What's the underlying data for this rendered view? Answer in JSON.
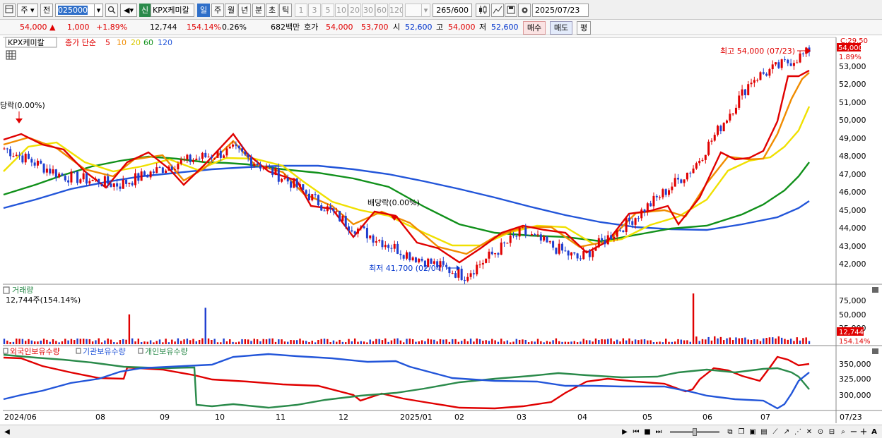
{
  "toolbar": {
    "period_daily": "주",
    "period_prev": "전",
    "stock_code": "025000",
    "market_tag": "신",
    "stock_name": "KPX케미칼",
    "periods": [
      "일",
      "주",
      "월",
      "년",
      "분",
      "초",
      "틱"
    ],
    "active_period": "일",
    "intervals": [
      "1",
      "3",
      "5",
      "10",
      "20",
      "30",
      "60",
      "120"
    ],
    "count_display": "265/600",
    "date": "2025/07/23"
  },
  "info": {
    "price": "54,000",
    "change": "1,000",
    "change_pct": "+1.89%",
    "volume": "12,744",
    "volume_ratio": "154.14%",
    "turnover": "0.26%",
    "amount": "682백만",
    "quote_label": "호가",
    "ask": "54,000",
    "bid": "53,700",
    "open_label": "시",
    "open": "52,600",
    "high_label": "고",
    "high": "54,000",
    "low_label": "저",
    "low": "52,600",
    "buy_label": "매수",
    "sell_label": "매도",
    "avg_label": "평"
  },
  "price_panel": {
    "legend_name": "KPX케미칼",
    "legend_ma": "종가 단순",
    "ma_periods": [
      "5",
      "10",
      "20",
      "60",
      "120"
    ],
    "ma_colors": [
      "#e00000",
      "#f08c00",
      "#f0e000",
      "#10901a",
      "#2255d9"
    ],
    "yaxis_labels": [
      "53,000",
      "52,000",
      "51,000",
      "50,000",
      "49,000",
      "48,000",
      "47,000",
      "46,000",
      "45,000",
      "44,000",
      "43,000",
      "42,000"
    ],
    "corner_label": "C:29.50",
    "current_price_tag": "54,000",
    "current_pct_tag": "1.89%",
    "annotation_high": "최고 54,000 (07/23)",
    "annotation_low": "최저 41,700 (02/04)",
    "annotation_div1": "당락(0.00%)",
    "annotation_div2": "배당락(0.00%)"
  },
  "volume_panel": {
    "title": "거래량",
    "value_label": "12,744주(154.14%)",
    "yaxis_labels": [
      "75,000",
      "50,000",
      "25,000"
    ],
    "tag_value": "12,744",
    "tag_pct": "154.14%"
  },
  "holdings_panel": {
    "legends": [
      "외국인보유수량",
      "기관보유수량",
      "개인보유수량"
    ],
    "colors": [
      "#e00000",
      "#2255d9",
      "#2a8a4a"
    ],
    "yaxis_labels": [
      "350,000",
      "325,000",
      "300,000"
    ]
  },
  "xaxis_labels": [
    "2024/06",
    "08",
    "09",
    "10",
    "11",
    "12",
    "2025/01",
    "02",
    "03",
    "04",
    "05",
    "06",
    "07"
  ],
  "xaxis_end_label": "07/23",
  "chart_data": {
    "type": "candlestick",
    "title": "KPX케미칼",
    "ylim": [
      41500,
      54300
    ],
    "close_series": [
      {
        "date": "2024/06",
        "close": 48700
      },
      {
        "date": "2024/07",
        "close": 47200
      },
      {
        "date": "2024/08",
        "close": 46700
      },
      {
        "date": "2024/09",
        "close": 47900
      },
      {
        "date": "2024/10",
        "close": 48600
      },
      {
        "date": "2024/11",
        "close": 46800
      },
      {
        "date": "2024/12",
        "close": 44500
      },
      {
        "date": "2025/01",
        "close": 42900
      },
      {
        "date": "2025/02",
        "close": 41700
      },
      {
        "date": "2025/03",
        "close": 44100
      },
      {
        "date": "2025/04",
        "close": 42600
      },
      {
        "date": "2025/05",
        "close": 45000
      },
      {
        "date": "2025/06",
        "close": 47700
      },
      {
        "date": "2025/07",
        "close": 52500
      },
      {
        "date": "2025/07/23",
        "close": 54000
      }
    ],
    "high": {
      "value": 54000,
      "date": "07/23"
    },
    "low": {
      "value": 41700,
      "date": "02/04"
    }
  }
}
